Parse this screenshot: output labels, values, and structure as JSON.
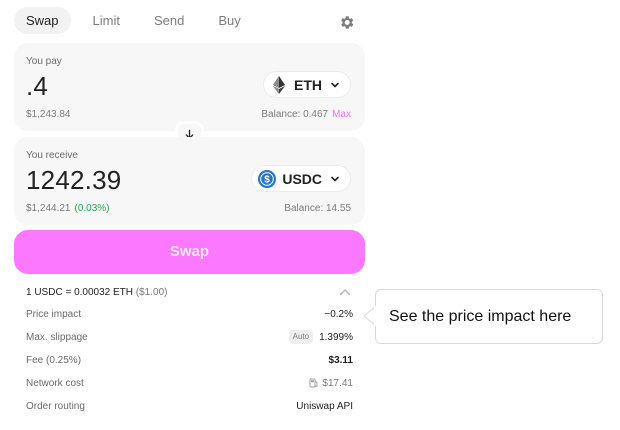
{
  "tabs": [
    {
      "label": "Swap",
      "active": true
    },
    {
      "label": "Limit",
      "active": false
    },
    {
      "label": "Send",
      "active": false
    },
    {
      "label": "Buy",
      "active": false
    }
  ],
  "pay": {
    "label": "You pay",
    "amount": ".4",
    "usd": "$1,243.84",
    "token": "ETH",
    "token_icon": "eth-icon",
    "balance": "Balance: 0.467",
    "max_label": "Max"
  },
  "receive": {
    "label": "You receive",
    "amount": "1242.39",
    "usd": "$1,244.21",
    "impact": "(0.03%)",
    "token": "USDC",
    "token_icon": "usdc-icon",
    "balance": "Balance: 14.55"
  },
  "swap_button": "Swap",
  "rate": {
    "text": "1 USDC = 0.00032 ETH",
    "usd": "($1.00)"
  },
  "details": [
    {
      "key": "Price impact",
      "value": "−0.2%",
      "style": "normal"
    },
    {
      "key": "Max. slippage",
      "badge": "Auto",
      "value": "1.399%",
      "style": "normal"
    },
    {
      "key": "Fee (0.25%)",
      "value": "$3.11",
      "style": "bold"
    },
    {
      "key": "Network cost",
      "value": "$17.41",
      "style": "grey",
      "icon": "gas-pump-icon"
    },
    {
      "key": "Order routing",
      "value": "Uniswap API",
      "style": "normal"
    }
  ],
  "callout": "See the price impact here",
  "colors": {
    "accent": "#fc72ff",
    "positive": "#21a64b",
    "usdc": "#2775ca"
  }
}
